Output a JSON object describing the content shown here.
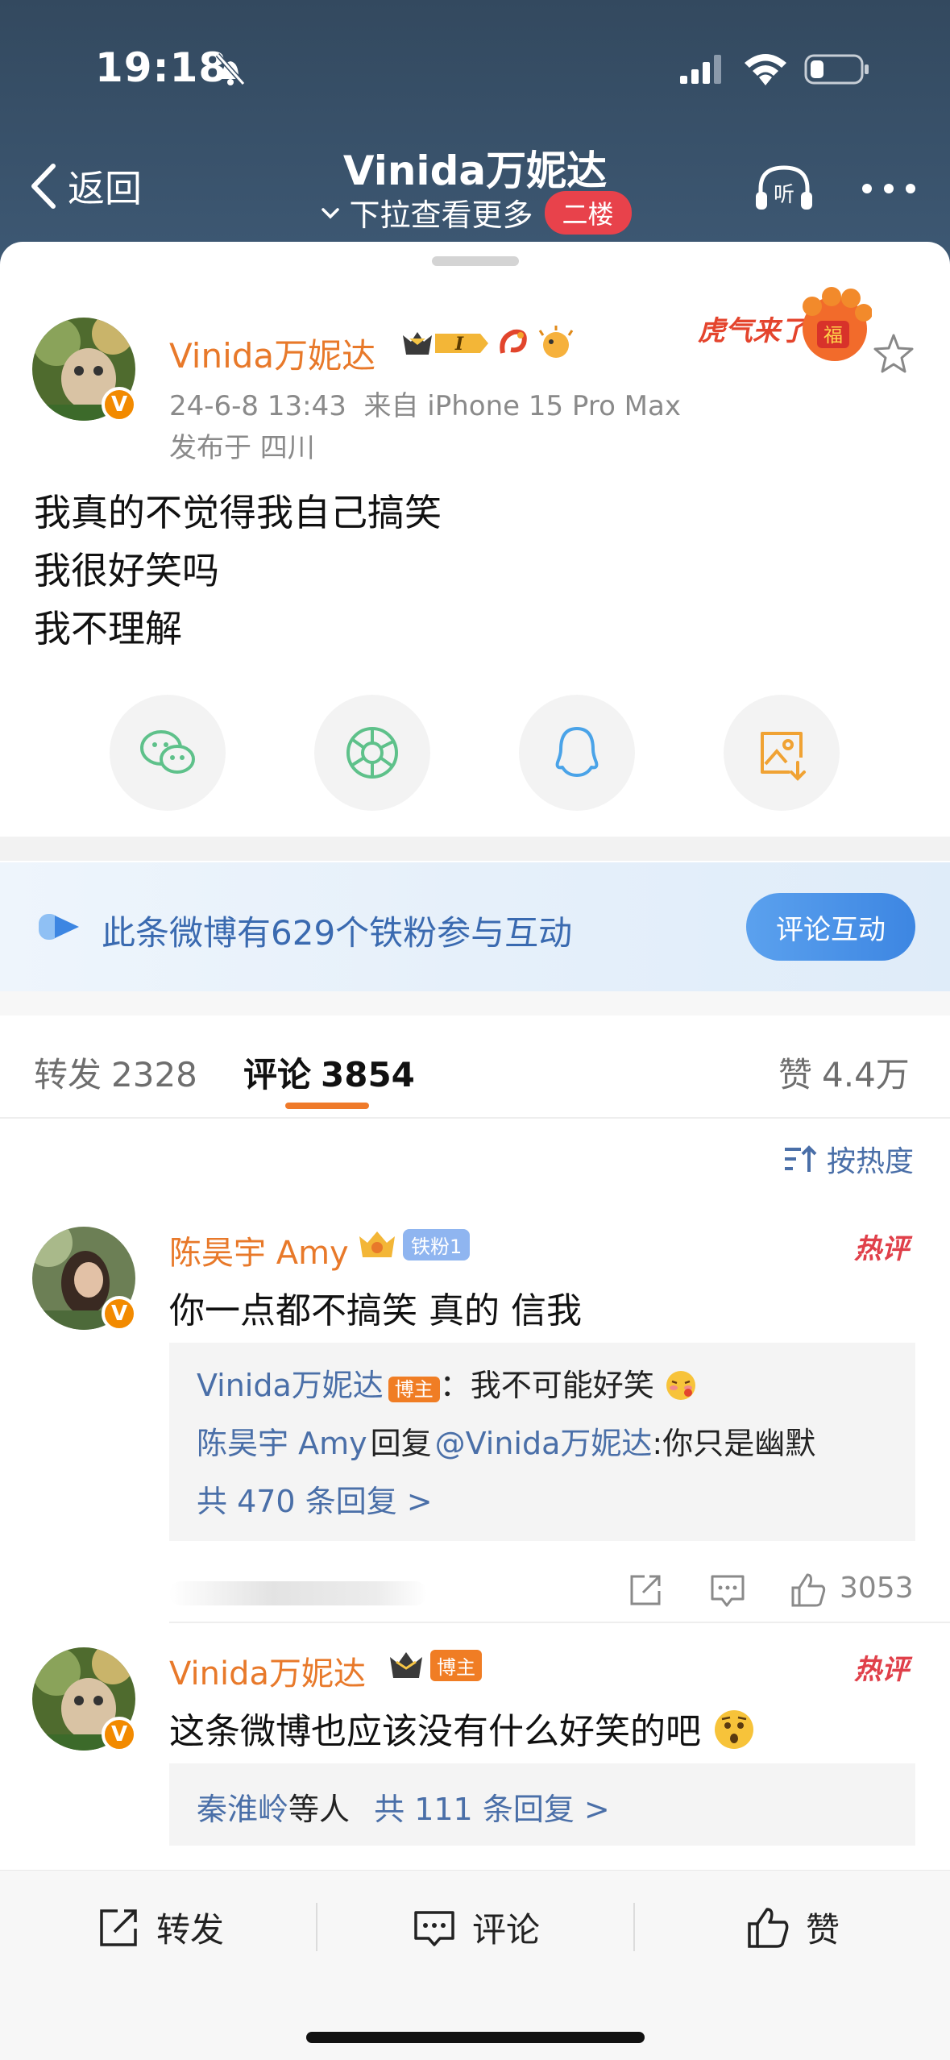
{
  "status": {
    "time": "19:18"
  },
  "nav": {
    "back_label": "返回",
    "title": "Vinida万妮达",
    "subtitle": "下拉查看更多",
    "floor_badge": "二楼",
    "listen_label": "听"
  },
  "post": {
    "author": "Vinida万妮达",
    "level_badge": "I",
    "sticker_text": "虎气来了",
    "sticker_seal": "福",
    "time": "24-6-8 13:43",
    "source": "来自 iPhone 15 Pro Max",
    "location": "发布于 四川",
    "verified_mark": "V",
    "text_lines": [
      "我真的不觉得我自己搞笑",
      "我很好笑吗",
      "我不理解"
    ]
  },
  "share": {
    "icons": [
      "wechat-icon",
      "moments-icon",
      "qq-icon",
      "save-image-icon"
    ]
  },
  "fans_banner": {
    "text": "此条微博有629个铁粉参与互动",
    "button": "评论互动"
  },
  "tabs": [
    {
      "label": "转发",
      "count": "2328"
    },
    {
      "label": "评论",
      "count": "3854"
    },
    {
      "label": "赞",
      "count": "4.4万"
    }
  ],
  "sort": {
    "label": "按热度"
  },
  "comments": [
    {
      "author": "陈昊宇 Amy",
      "fan_badge": "铁粉1",
      "hot_tag": "热评",
      "text": "你一点都不搞笑 真的 信我",
      "replies": {
        "line1_author": "Vinida万妮达",
        "line1_badge": "博主",
        "line1_text": "：我不可能好笑",
        "line2_author": "陈昊宇 Amy",
        "line2_mid": "回复",
        "line2_mention": "@Vinida万妮达",
        "line2_text": ":你只是幽默",
        "more": "共 470 条回复 >"
      },
      "likes": "3053"
    },
    {
      "author": "Vinida万妮达",
      "host_badge": "博主",
      "hot_tag": "热评",
      "text": "这条微博也应该没有什么好笑的吧",
      "replies": {
        "names": "秦淮岭",
        "names_suffix": "等人",
        "more": "共 111 条回复 >"
      }
    }
  ],
  "bottom_bar": {
    "repost": "转发",
    "comment": "评论",
    "like": "赞"
  },
  "colors": {
    "header_bg": "#3c5470",
    "accent_orange": "#e8792a",
    "link_blue": "#4a6fa8",
    "hot_red": "#e0404a"
  }
}
